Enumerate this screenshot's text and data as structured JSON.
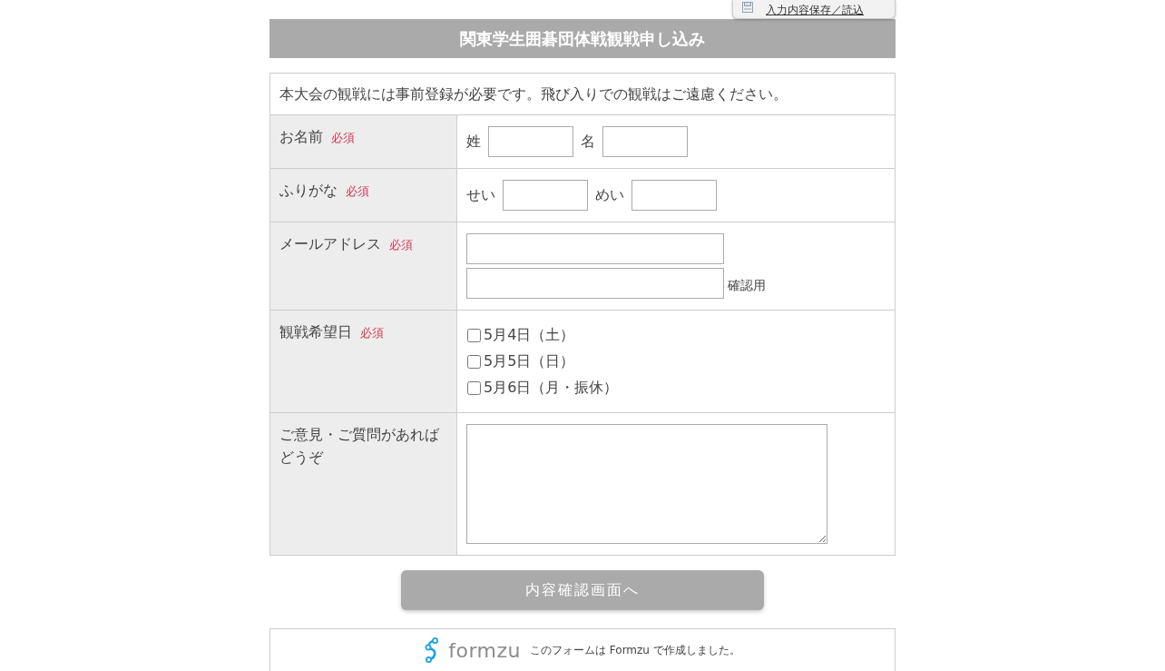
{
  "save_link": {
    "label": "入力内容保存／読込"
  },
  "title": "関東学生囲碁団体戦観戦申し込み",
  "intro": "本大会の観戦には事前登録が必要です。飛び入りでの観戦はご遠慮ください。",
  "fields": [
    {
      "kind": "name_pair",
      "label": "お名前",
      "required_label": "必須",
      "parts": [
        {
          "label": "姓"
        },
        {
          "label": "名"
        }
      ]
    },
    {
      "kind": "name_pair",
      "label": "ふりがな",
      "required_label": "必須",
      "parts": [
        {
          "label": "せい"
        },
        {
          "label": "めい"
        }
      ]
    },
    {
      "kind": "email",
      "label": "メールアドレス",
      "required_label": "必須",
      "confirm_label": "確認用"
    },
    {
      "kind": "checkboxes",
      "label": "観戦希望日",
      "required_label": "必須",
      "options": [
        {
          "label": "5月4日（土）",
          "checked": false
        },
        {
          "label": "5月5日（日）",
          "checked": false
        },
        {
          "label": "5月6日（月・振休）",
          "checked": false
        }
      ]
    },
    {
      "kind": "textarea",
      "label": "ご意見・ご質問があればどうぞ"
    }
  ],
  "submit_button": "内容確認画面へ",
  "footer": {
    "logo_text": "formzu",
    "note": "このフォームは Formzu で作成しました。"
  }
}
